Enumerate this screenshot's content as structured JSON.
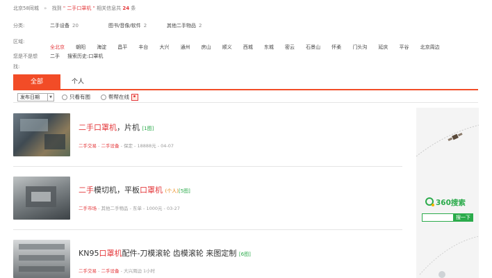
{
  "breadcrumb": {
    "city": "北京58同城",
    "sep": "»",
    "find": "找到",
    "kw_open": "\"",
    "keyword": "二手口罩机",
    "kw_close": "\"",
    "related_prefix": "相关信息共",
    "count": "24",
    "unit": "条"
  },
  "filters": {
    "category_label": "分类:",
    "categories": [
      {
        "name": "二手设备",
        "count": "20"
      },
      {
        "name": "图书/音像/软件",
        "count": "2"
      },
      {
        "name": "其他二手物品",
        "count": "2"
      }
    ],
    "area_label": "区域:",
    "districts": [
      "全北京",
      "朝阳",
      "海淀",
      "昌平",
      "丰台",
      "大兴",
      "通州",
      "房山",
      "顺义",
      "西城",
      "东城",
      "密云",
      "石景山",
      "怀柔",
      "门头沟",
      "延庆",
      "平谷",
      "北京周边"
    ],
    "maybe_label_1": "您是不是想",
    "maybe_label_2": "找:",
    "maybe_link": "二手",
    "history_label": "搜索历史:",
    "history_link": "口罩机"
  },
  "tabs": {
    "all": "全部",
    "person": "个人"
  },
  "toolbar": {
    "sort_value": "发布日期",
    "only_images": "只看有图",
    "help_online": "帮帮在线"
  },
  "listings": [
    {
      "title_parts": [
        "二手口罩机",
        "，片机"
      ],
      "title_red": [
        true,
        false
      ],
      "img_count": "[1图]",
      "meta_a": "二手交易",
      "meta_b": "二手设备",
      "meta_rest": "- 保定 - 18888元 - 04-07"
    },
    {
      "title_parts": [
        "二手",
        "模切机，平板",
        "口罩机"
      ],
      "title_red": [
        true,
        false,
        true
      ],
      "tag": "(个人)",
      "img_count": "[5图]",
      "meta_a": "二手市场",
      "meta_b": "其他二手物品",
      "meta_rest": "- 东单 - 1000元 - 03-27"
    },
    {
      "title_parts": [
        "KN95",
        "口罩机",
        "配件-刀模滚轮 齿模滚轮 来图定制"
      ],
      "title_red": [
        false,
        true,
        false
      ],
      "img_count": "[6图]",
      "meta_a": "二手交易",
      "meta_b": "二手设备",
      "meta_rest": "- 大兴周边 1小时"
    }
  ],
  "ad": {
    "brand": "360搜索",
    "search_button": "搜一下"
  }
}
